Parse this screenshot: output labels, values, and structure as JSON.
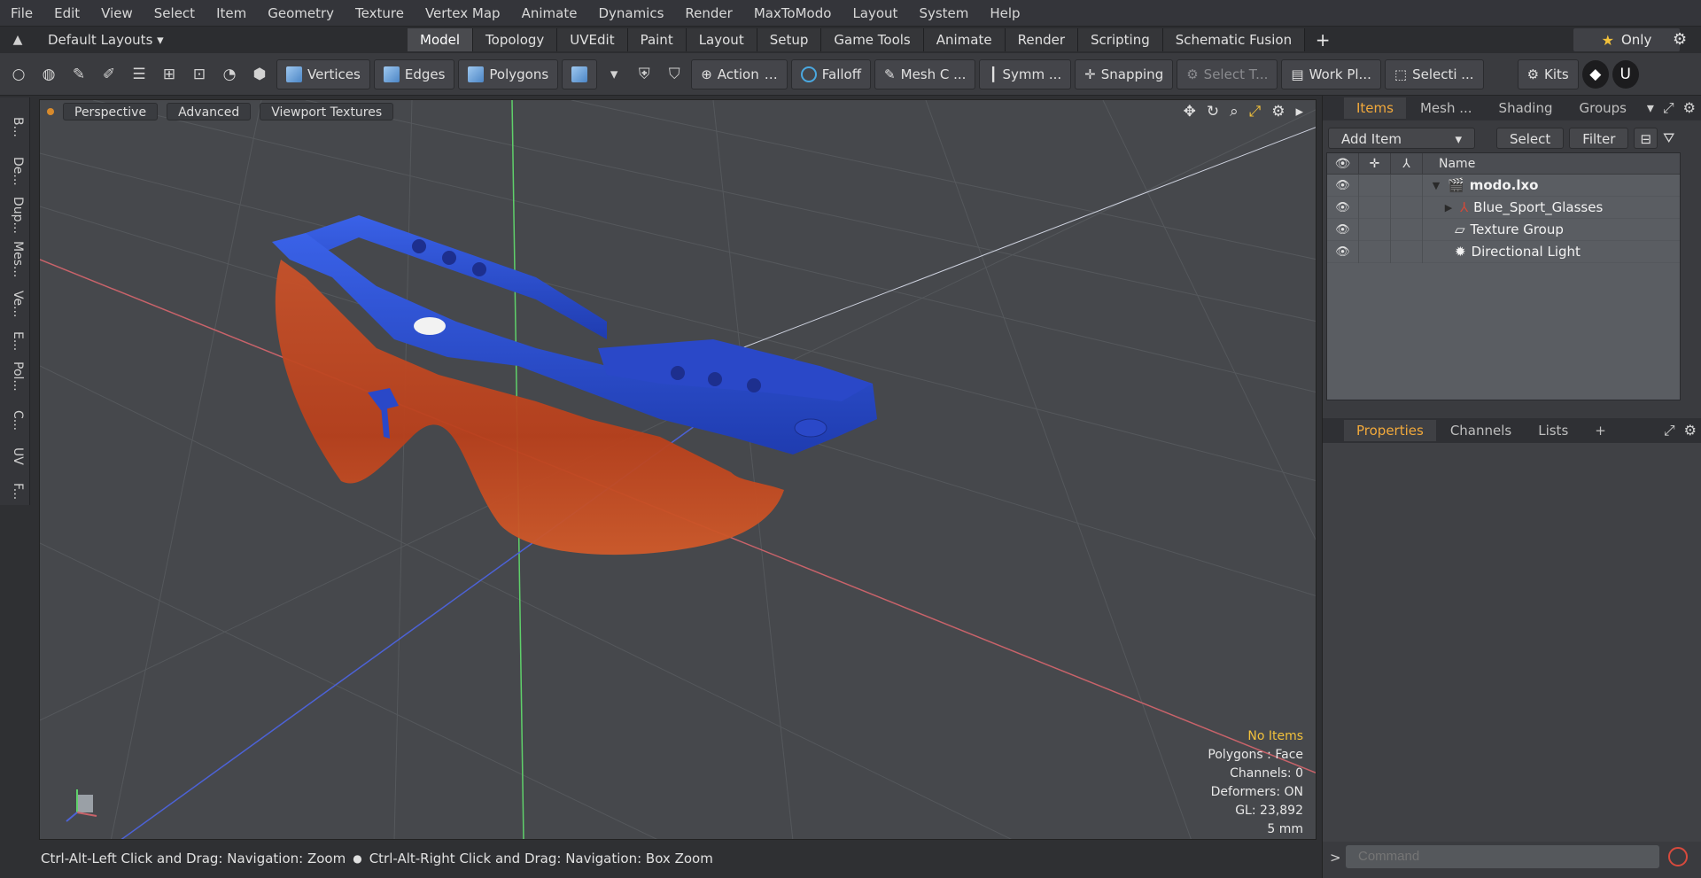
{
  "menu": [
    "File",
    "Edit",
    "View",
    "Select",
    "Item",
    "Geometry",
    "Texture",
    "Vertex Map",
    "Animate",
    "Dynamics",
    "Render",
    "MaxToModo",
    "Layout",
    "System",
    "Help"
  ],
  "layout_bar": {
    "layouts_label": "Default Layouts",
    "tabs": [
      "Model",
      "Topology",
      "UVEdit",
      "Paint",
      "Layout",
      "Setup",
      "Game Tools",
      "Animate",
      "Render",
      "Scripting",
      "Schematic Fusion"
    ],
    "active_tab": "Model",
    "only_label": "Only"
  },
  "toolbar": {
    "vertices": "Vertices",
    "edges": "Edges",
    "polygons": "Polygons",
    "action": "Action",
    "falloff": "Falloff",
    "mesh": "Mesh C ...",
    "symmetry": "Symm ...",
    "snapping": "Snapping",
    "select_through": "Select T...",
    "work_plane": "Work Pl...",
    "selection": "Selecti ...",
    "kits": "Kits"
  },
  "left_tabs": [
    "B...",
    "De...",
    "Dup...",
    "Mes...",
    "Ve...",
    "E...",
    "Pol...",
    "C...",
    "UV",
    "F..."
  ],
  "viewport": {
    "view_mode": "Perspective",
    "shading": "Advanced",
    "textures": "Viewport Textures",
    "info": {
      "selection": "No Items",
      "polygons": "Polygons : Face",
      "channels": "Channels: 0",
      "deformers": "Deformers: ON",
      "gl": "GL: 23,892",
      "grid": "5 mm"
    },
    "colors": {
      "frame": "#2b4fd6",
      "lens": "#c0481c"
    }
  },
  "status_bar": {
    "hint_left": "Ctrl-Alt-Left Click and Drag: Navigation: Zoom",
    "hint_right": "Ctrl-Alt-Right Click and Drag: Navigation: Box Zoom"
  },
  "items_panel": {
    "tabs": [
      "Items",
      "Mesh ...",
      "Shading",
      "Groups"
    ],
    "active_tab": "Items",
    "add_item": "Add Item",
    "select": "Select",
    "filter": "Filter",
    "col_name": "Name",
    "rows": [
      {
        "name": "modo.lxo",
        "icon": "scene-icon"
      },
      {
        "name": "Blue_Sport_Glasses",
        "icon": "mesh-icon"
      },
      {
        "name": "Texture Group",
        "icon": "texture-group-icon"
      },
      {
        "name": "Directional Light",
        "icon": "light-icon"
      }
    ]
  },
  "properties_panel": {
    "tabs": [
      "Properties",
      "Channels",
      "Lists"
    ],
    "active_tab": "Properties",
    "command_placeholder": "Command"
  }
}
